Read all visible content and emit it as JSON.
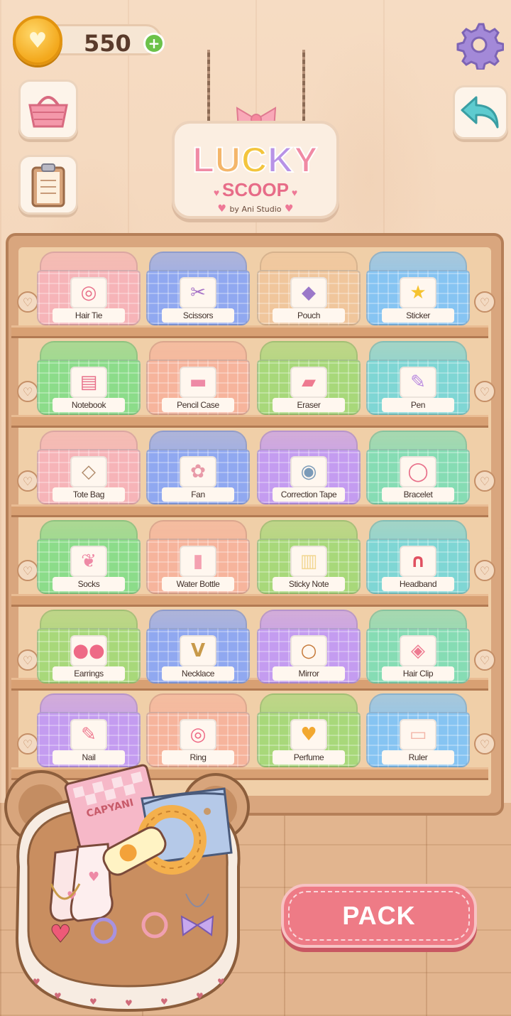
{
  "currency": {
    "value": "550",
    "plus_symbol": "+"
  },
  "sign": {
    "title_letters": [
      "L",
      "U",
      "C",
      "K",
      "Y"
    ],
    "subtitle": "SCOOP",
    "studio": "by Ani Studio"
  },
  "action": {
    "pack_label": "PACK"
  },
  "basket": {
    "notebook_text": "CAPYANI"
  },
  "colors": {
    "pink": "#f6b4b8",
    "blue": "#90a8f0",
    "tan": "#f0c69c",
    "sky": "#86c4f2",
    "green": "#8cdc8a",
    "peach": "#f6b49c",
    "lime": "#a8d87a",
    "teal": "#7fd6d4",
    "purple": "#c49cf0",
    "mint": "#86dcb4"
  },
  "shelves": [
    {
      "items": [
        {
          "label": "Hair Tie",
          "icon": "hair-tie-icon",
          "color": "#f6b4b8",
          "glyph": "◎",
          "glyph_color": "#e8708a"
        },
        {
          "label": "Scissors",
          "icon": "scissors-icon",
          "color": "#90a8f0",
          "glyph": "✂",
          "glyph_color": "#a774c8"
        },
        {
          "label": "Pouch",
          "icon": "pouch-icon",
          "color": "#f0c69c",
          "glyph": "◆",
          "glyph_color": "#9b78c9"
        },
        {
          "label": "Sticker",
          "icon": "star-sticker-icon",
          "color": "#86c4f2",
          "glyph": "★",
          "glyph_color": "#f5c330"
        }
      ]
    },
    {
      "items": [
        {
          "label": "Notebook",
          "icon": "notebook-icon",
          "color": "#8cdc8a",
          "glyph": "▤",
          "glyph_color": "#e8708a"
        },
        {
          "label": "Pencil Case",
          "icon": "pencil-case-icon",
          "color": "#f6b49c",
          "glyph": "▬",
          "glyph_color": "#ee8aa6"
        },
        {
          "label": "Eraser",
          "icon": "eraser-icon",
          "color": "#a8d87a",
          "glyph": "▰",
          "glyph_color": "#ee7a90"
        },
        {
          "label": "Pen",
          "icon": "pen-icon",
          "color": "#7fd6d4",
          "glyph": "✎",
          "glyph_color": "#b98ae0"
        }
      ]
    },
    {
      "items": [
        {
          "label": "Tote Bag",
          "icon": "tote-bag-icon",
          "color": "#f6b4b8",
          "glyph": "◇",
          "glyph_color": "#b08a6a"
        },
        {
          "label": "Fan",
          "icon": "fan-icon",
          "color": "#90a8f0",
          "glyph": "✿",
          "glyph_color": "#e89aa8"
        },
        {
          "label": "Correction Tape",
          "icon": "correction-tape-icon",
          "color": "#c49cf0",
          "glyph": "◉",
          "glyph_color": "#7a9ab8"
        },
        {
          "label": "Bracelet",
          "icon": "bracelet-icon",
          "color": "#86dcb4",
          "glyph": "◯",
          "glyph_color": "#e8708a"
        }
      ]
    },
    {
      "items": [
        {
          "label": "Socks",
          "icon": "socks-icon",
          "color": "#8cdc8a",
          "glyph": "❦",
          "glyph_color": "#ee8aa6"
        },
        {
          "label": "Water Bottle",
          "icon": "water-bottle-icon",
          "color": "#f6b49c",
          "glyph": "▮",
          "glyph_color": "#f4a0b0"
        },
        {
          "label": "Sticky Note",
          "icon": "sticky-note-icon",
          "color": "#a8d87a",
          "glyph": "▥",
          "glyph_color": "#f2d690"
        },
        {
          "label": "Headband",
          "icon": "headband-icon",
          "color": "#7fd6d4",
          "glyph": "∩",
          "glyph_color": "#e05060"
        }
      ]
    },
    {
      "items": [
        {
          "label": "Earrings",
          "icon": "earrings-icon",
          "color": "#a8d87a",
          "glyph": "●●",
          "glyph_color": "#ee6a86"
        },
        {
          "label": "Necklace",
          "icon": "necklace-icon",
          "color": "#90a8f0",
          "glyph": "V",
          "glyph_color": "#c89a4a"
        },
        {
          "label": "Mirror",
          "icon": "mirror-icon",
          "color": "#c49cf0",
          "glyph": "○",
          "glyph_color": "#c67a3a"
        },
        {
          "label": "Hair Clip",
          "icon": "hair-clip-icon",
          "color": "#86dcb4",
          "glyph": "◈",
          "glyph_color": "#ee7a90"
        }
      ]
    },
    {
      "items": [
        {
          "label": "Nail",
          "icon": "nail-icon",
          "color": "#c49cf0",
          "glyph": "✎",
          "glyph_color": "#ee7a90"
        },
        {
          "label": "Ring",
          "icon": "ring-icon",
          "color": "#f6b49c",
          "glyph": "◎",
          "glyph_color": "#ee6a86"
        },
        {
          "label": "Perfume",
          "icon": "perfume-icon",
          "color": "#a8d87a",
          "glyph": "♥",
          "glyph_color": "#f2a830"
        },
        {
          "label": "Ruler",
          "icon": "ruler-icon",
          "color": "#86c4f2",
          "glyph": "▭",
          "glyph_color": "#f3b6a8"
        }
      ]
    }
  ]
}
